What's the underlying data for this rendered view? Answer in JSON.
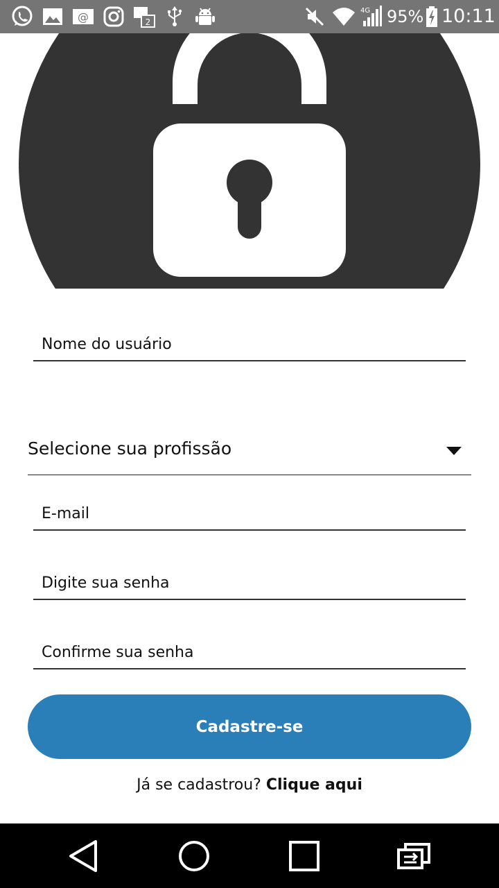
{
  "status_bar": {
    "battery_percent": "95%",
    "time": "10:11",
    "network_type": "4G",
    "left_icons": [
      "whatsapp-icon",
      "gallery-icon",
      "email-icon",
      "instagram-icon",
      "translate-icon",
      "usb-icon",
      "android-debug-icon"
    ],
    "right_icons": [
      "mute-icon",
      "wifi-icon",
      "signal-icon",
      "battery-charging-icon"
    ]
  },
  "header": {
    "icon": "lock-icon",
    "circle_color": "#333333"
  },
  "form": {
    "username_placeholder": "Nome do usuário",
    "profession_select": {
      "selected_label": "Selecione sua profissão"
    },
    "email_placeholder": "E-mail",
    "password_placeholder": "Digite sua senha",
    "confirm_password_placeholder": "Confirme sua senha",
    "submit_label": "Cadastre-se",
    "accent_color": "#2b7fb8"
  },
  "footer": {
    "already_registered_text": "Já se cadastrou?",
    "login_link_label": "Clique aqui"
  },
  "nav_bar": {
    "buttons": [
      "back-icon",
      "home-icon",
      "recents-icon",
      "switch-apps-icon"
    ]
  }
}
